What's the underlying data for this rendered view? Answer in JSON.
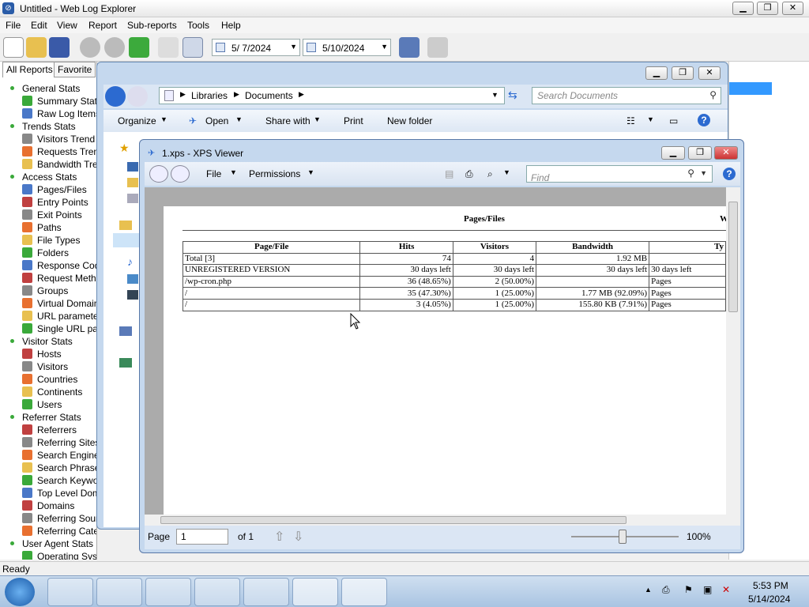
{
  "app": {
    "title": "Untitled - Web Log Explorer",
    "menu": [
      "File",
      "Edit",
      "View",
      "Report",
      "Sub-reports",
      "Tools",
      "Help"
    ],
    "date_from": "5/ 7/2024",
    "date_to": "5/10/2024",
    "status": "Ready"
  },
  "tree": {
    "tabs": [
      "All Reports",
      "Favorite"
    ],
    "items": [
      {
        "label": "General Stats",
        "level": 0
      },
      {
        "label": "Summary Stats",
        "level": 1
      },
      {
        "label": "Raw Log Items",
        "level": 1
      },
      {
        "label": "Trends Stats",
        "level": 0
      },
      {
        "label": "Visitors Trend",
        "level": 1
      },
      {
        "label": "Requests Trend",
        "level": 1
      },
      {
        "label": "Bandwidth Trend",
        "level": 1
      },
      {
        "label": "Access Stats",
        "level": 0
      },
      {
        "label": "Pages/Files",
        "level": 1
      },
      {
        "label": "Entry Points",
        "level": 1
      },
      {
        "label": "Exit Points",
        "level": 1
      },
      {
        "label": "Paths",
        "level": 1
      },
      {
        "label": "File Types",
        "level": 1
      },
      {
        "label": "Folders",
        "level": 1
      },
      {
        "label": "Response Codes",
        "level": 1
      },
      {
        "label": "Request Methods",
        "level": 1
      },
      {
        "label": "Groups",
        "level": 1
      },
      {
        "label": "Virtual Domains",
        "level": 1
      },
      {
        "label": "URL parameters",
        "level": 1
      },
      {
        "label": "Single URL parameters",
        "level": 1
      },
      {
        "label": "Visitor Stats",
        "level": 0
      },
      {
        "label": "Hosts",
        "level": 1
      },
      {
        "label": "Visitors",
        "level": 1
      },
      {
        "label": "Countries",
        "level": 1
      },
      {
        "label": "Continents",
        "level": 1
      },
      {
        "label": "Users",
        "level": 1
      },
      {
        "label": "Referrer Stats",
        "level": 0
      },
      {
        "label": "Referrers",
        "level": 1
      },
      {
        "label": "Referring Sites",
        "level": 1
      },
      {
        "label": "Search Engines",
        "level": 1
      },
      {
        "label": "Search Phrases",
        "level": 1
      },
      {
        "label": "Search Keywords",
        "level": 1
      },
      {
        "label": "Top Level Domains",
        "level": 1
      },
      {
        "label": "Domains",
        "level": 1
      },
      {
        "label": "Referring Sources",
        "level": 1
      },
      {
        "label": "Referring Categories",
        "level": 1
      },
      {
        "label": "User Agent Stats",
        "level": 0
      },
      {
        "label": "Operating Systems",
        "level": 1
      }
    ]
  },
  "explorer": {
    "breadcrumb": [
      "Libraries",
      "Documents"
    ],
    "search_placeholder": "Search Documents",
    "commands": [
      "Organize",
      "Open",
      "Share with",
      "Print",
      "New folder"
    ]
  },
  "xps": {
    "title": "1.xps - XPS Viewer",
    "menus": [
      "File",
      "Permissions"
    ],
    "find_placeholder": "Find",
    "report_title": "Pages/Files",
    "report_title_cut": "W",
    "columns": [
      "Page/File",
      "Hits",
      "Visitors",
      "Bandwidth",
      "Ty"
    ],
    "rows": [
      [
        "Total [3]",
        "74",
        "4",
        "1.92 MB",
        ""
      ],
      [
        "UNREGISTERED VERSION",
        "30 days left",
        "30 days left",
        "30 days left",
        "30 days left"
      ],
      [
        "/wp-cron.php",
        "36 (48.65%)",
        "2 (50.00%)",
        "",
        "Pages"
      ],
      [
        "/",
        "35 (47.30%)",
        "1 (25.00%)",
        "1.77 MB (92.09%)",
        "Pages"
      ],
      [
        "/",
        "3 (4.05%)",
        "1 (25.00%)",
        "155.80 KB (7.91%)",
        "Pages"
      ]
    ],
    "page_label": "Page",
    "page_value": "1",
    "page_of": "of 1",
    "zoom": "100%"
  },
  "taskbar": {
    "time": "5:53 PM",
    "date": "5/14/2024"
  }
}
